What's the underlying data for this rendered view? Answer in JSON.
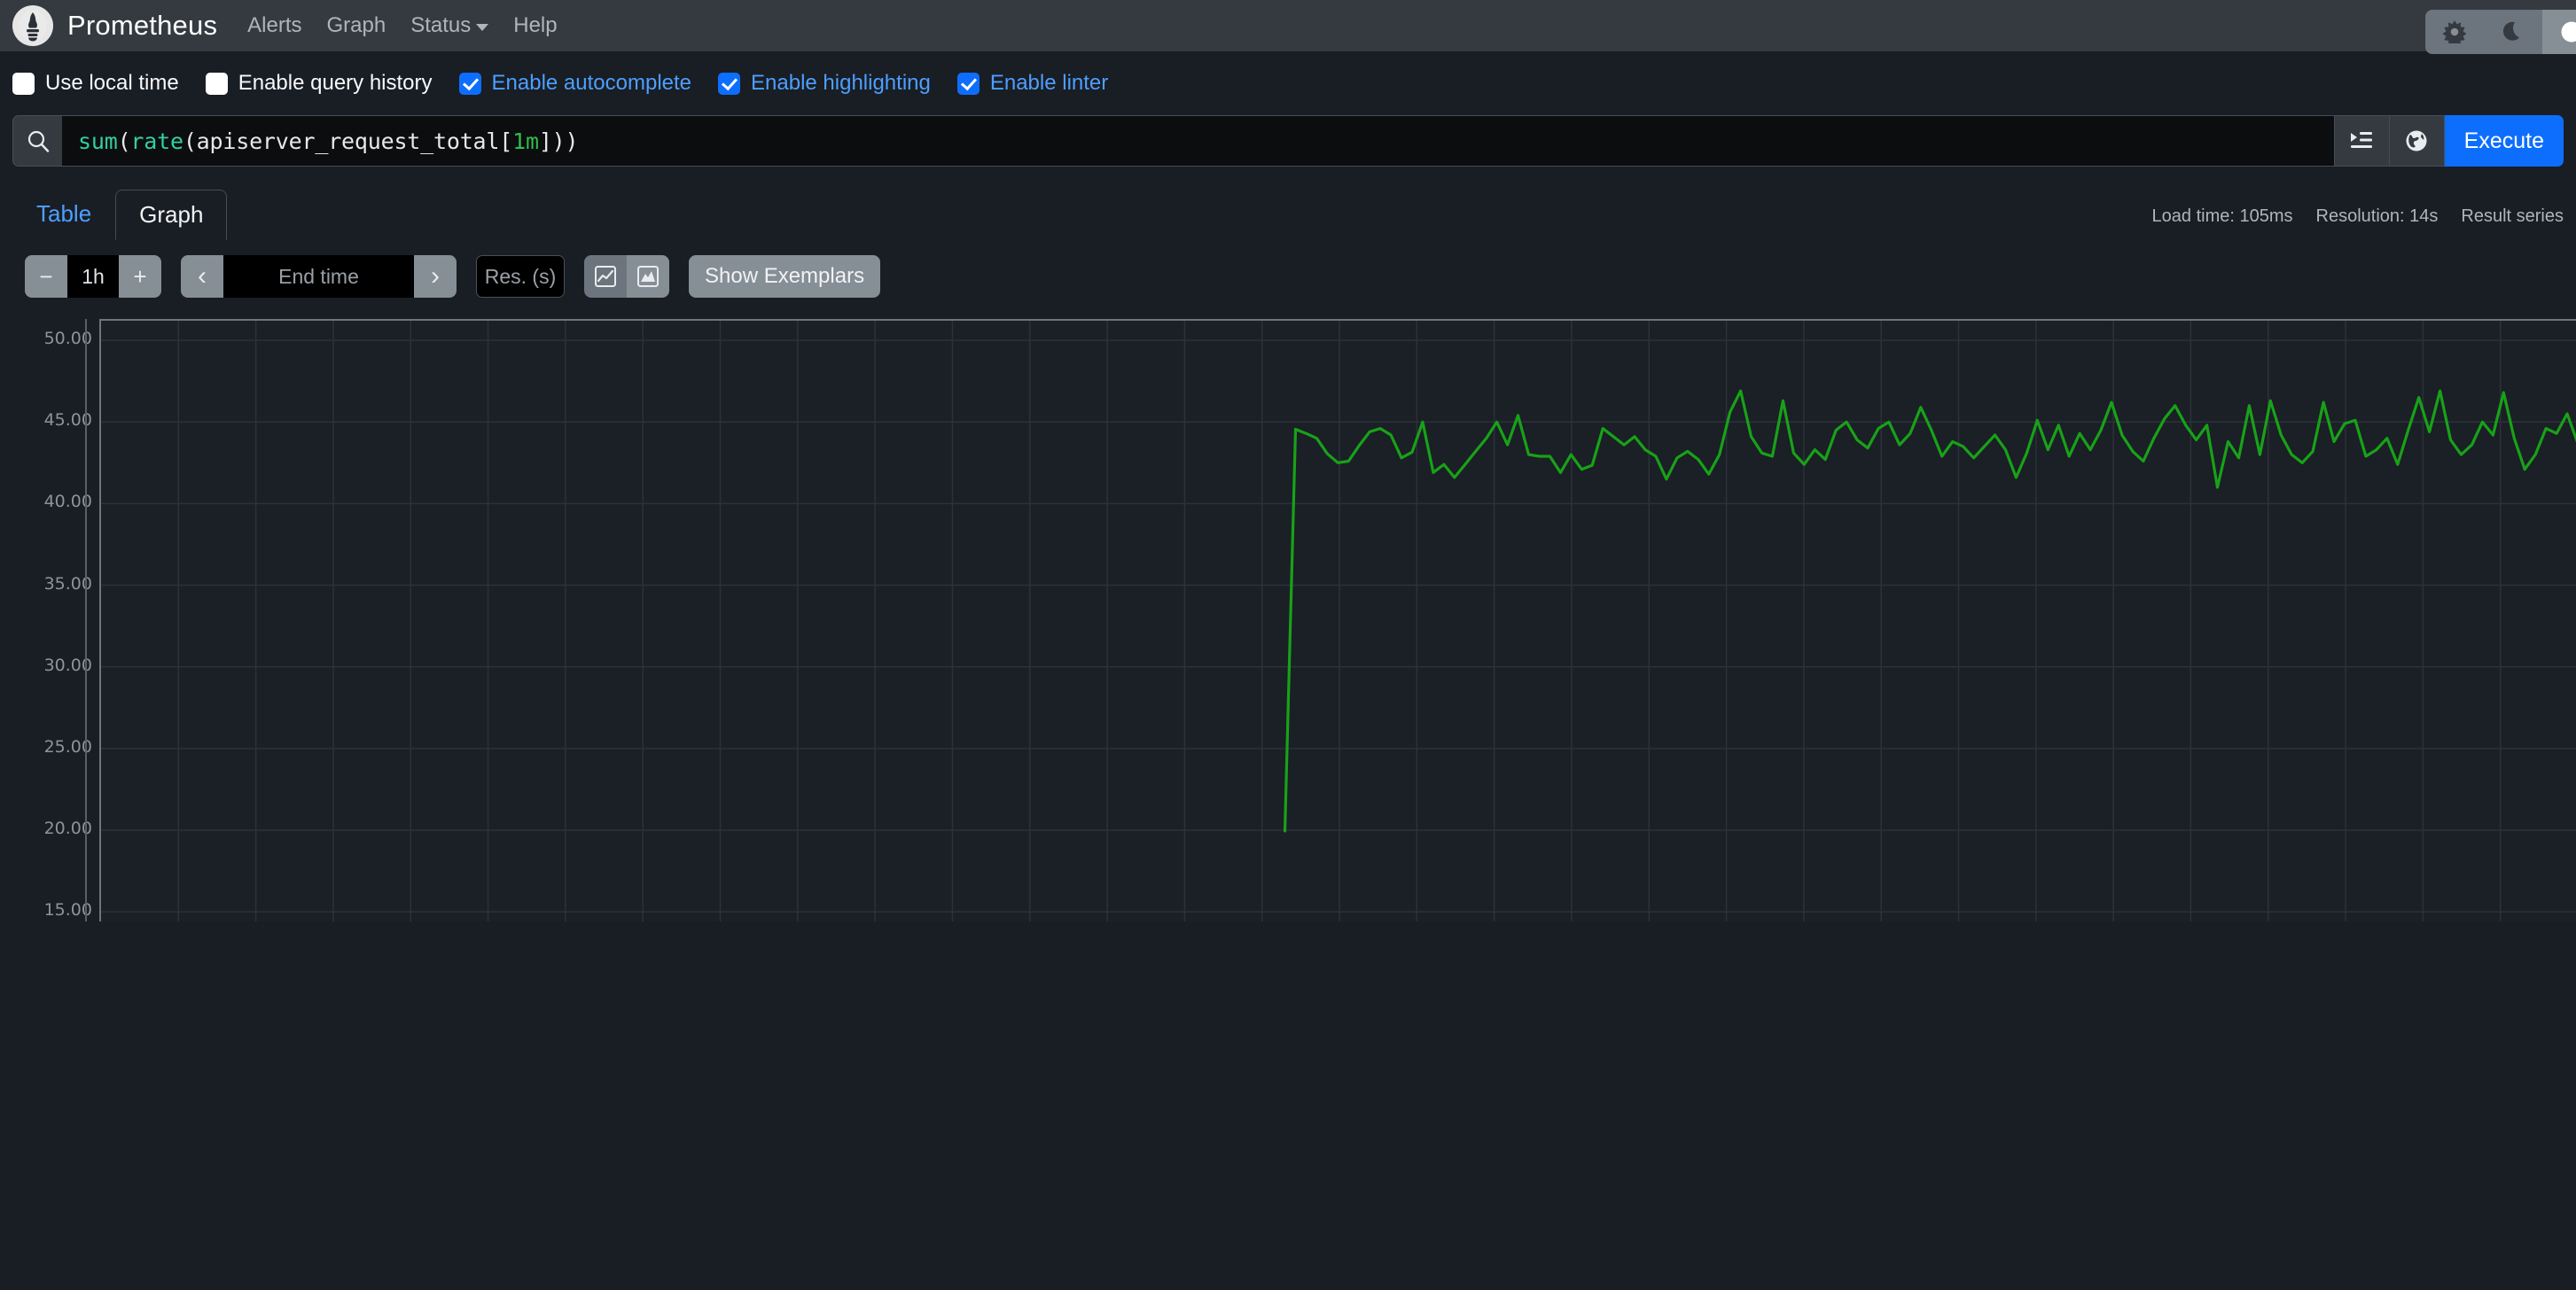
{
  "navbar": {
    "brand": "Prometheus",
    "logo_icon": "prometheus-torch-icon",
    "links": [
      {
        "label": "Alerts",
        "icon": null
      },
      {
        "label": "Graph",
        "icon": null
      },
      {
        "label": "Status",
        "icon": "caret-down-icon"
      },
      {
        "label": "Help",
        "icon": null
      }
    ],
    "theme_buttons": [
      {
        "name": "light-theme-button",
        "icon": "sun-icon",
        "selected": false
      },
      {
        "name": "dark-theme-button",
        "icon": "moon-icon",
        "selected": false
      },
      {
        "name": "auto-theme-button",
        "icon": "circle-icon",
        "selected": true
      }
    ]
  },
  "options": [
    {
      "label": "Use local time",
      "checked": false
    },
    {
      "label": "Enable query history",
      "checked": false
    },
    {
      "label": "Enable autocomplete",
      "checked": true
    },
    {
      "label": "Enable highlighting",
      "checked": true
    },
    {
      "label": "Enable linter",
      "checked": true
    }
  ],
  "query": {
    "search_icon": "magnifier-icon",
    "expression_plain": "sum(rate(apiserver_request_total[1m]))",
    "tokens": [
      {
        "text": "sum",
        "kind": "fn"
      },
      {
        "text": "(",
        "kind": "plain"
      },
      {
        "text": "rate",
        "kind": "fn"
      },
      {
        "text": "(apiserver_request_total[",
        "kind": "plain"
      },
      {
        "text": "1m",
        "kind": "dur"
      },
      {
        "text": "]))",
        "kind": "plain"
      }
    ],
    "format_button_icon": "indent-list-icon",
    "globe_button_icon": "globe-icon",
    "execute_label": "Execute"
  },
  "tabs": [
    {
      "label": "Table",
      "active": false
    },
    {
      "label": "Graph",
      "active": true
    }
  ],
  "stats": [
    "Load time: 105ms",
    "Resolution: 14s",
    "Result series"
  ],
  "graph_toolbar": {
    "decrease_range_label": "−",
    "range_value": "1h",
    "increase_range_label": "+",
    "prev_arrow": "‹",
    "end_time_placeholder": "End time",
    "next_arrow": "›",
    "resolution_placeholder": "Res. (s)",
    "chart_type_buttons": [
      {
        "name": "line-chart-button",
        "icon": "line-chart-icon",
        "selected": true
      },
      {
        "name": "stacked-chart-button",
        "icon": "area-chart-icon",
        "selected": false
      }
    ],
    "show_exemplars_label": "Show Exemplars"
  },
  "colors": {
    "accent": "#0d6efd",
    "link": "#4d9fff",
    "series_green": "#17a217",
    "navbar_bg": "#343a40",
    "page_bg": "#191d24",
    "plot_bg": "#1b1f26",
    "gridline": "#2c323a"
  },
  "chart_data": {
    "type": "line",
    "title": "",
    "xlabel": "",
    "ylabel": "",
    "ylim": [
      14.3,
      51.2
    ],
    "grid": true,
    "legend": "none",
    "y_ticks": [
      50.0,
      45.0,
      40.0,
      35.0,
      30.0,
      25.0,
      20.0,
      15.0
    ],
    "y_tick_labels": [
      "50.00",
      "45.00",
      "40.00",
      "35.00",
      "30.00",
      "25.00",
      "20.00",
      "15.00"
    ],
    "x_gridline_count": 32,
    "series": [
      {
        "name": "sum(rate(apiserver_request_total[1m]))",
        "color": "#17a217",
        "x_start_fraction": 0.478,
        "values": [
          19.95,
          44.55,
          44.3,
          44.0,
          43.05,
          42.5,
          42.6,
          43.55,
          44.4,
          44.6,
          44.2,
          42.8,
          43.15,
          45.0,
          41.9,
          42.4,
          41.6,
          42.4,
          43.2,
          44.0,
          45.0,
          43.6,
          45.4,
          43.0,
          42.9,
          42.9,
          41.9,
          43.0,
          42.1,
          42.35,
          44.6,
          44.1,
          43.6,
          44.1,
          43.3,
          42.9,
          41.5,
          42.8,
          43.2,
          42.7,
          41.8,
          43.0,
          45.6,
          46.9,
          44.1,
          43.1,
          42.9,
          46.3,
          43.1,
          42.4,
          43.3,
          42.7,
          44.5,
          45.0,
          43.9,
          43.4,
          44.6,
          45.0,
          43.6,
          44.3,
          45.9,
          44.5,
          42.9,
          43.8,
          43.5,
          42.8,
          43.5,
          44.2,
          43.3,
          41.6,
          43.1,
          45.1,
          43.3,
          44.8,
          42.9,
          44.3,
          43.3,
          44.5,
          46.2,
          44.2,
          43.2,
          42.6,
          44.0,
          45.2,
          46.0,
          44.8,
          43.9,
          44.8,
          41.0,
          43.8,
          42.8,
          46.0,
          43.0,
          46.3,
          44.2,
          43.0,
          42.5,
          43.2,
          46.2,
          43.8,
          44.9,
          45.1,
          42.9,
          43.3,
          44.0,
          42.4,
          44.5,
          46.5,
          44.4,
          46.9,
          43.9,
          43.0,
          43.6,
          45.0,
          44.2,
          46.8,
          44.0,
          42.1,
          43.0,
          44.6,
          44.3,
          45.5,
          43.7
        ]
      }
    ]
  }
}
